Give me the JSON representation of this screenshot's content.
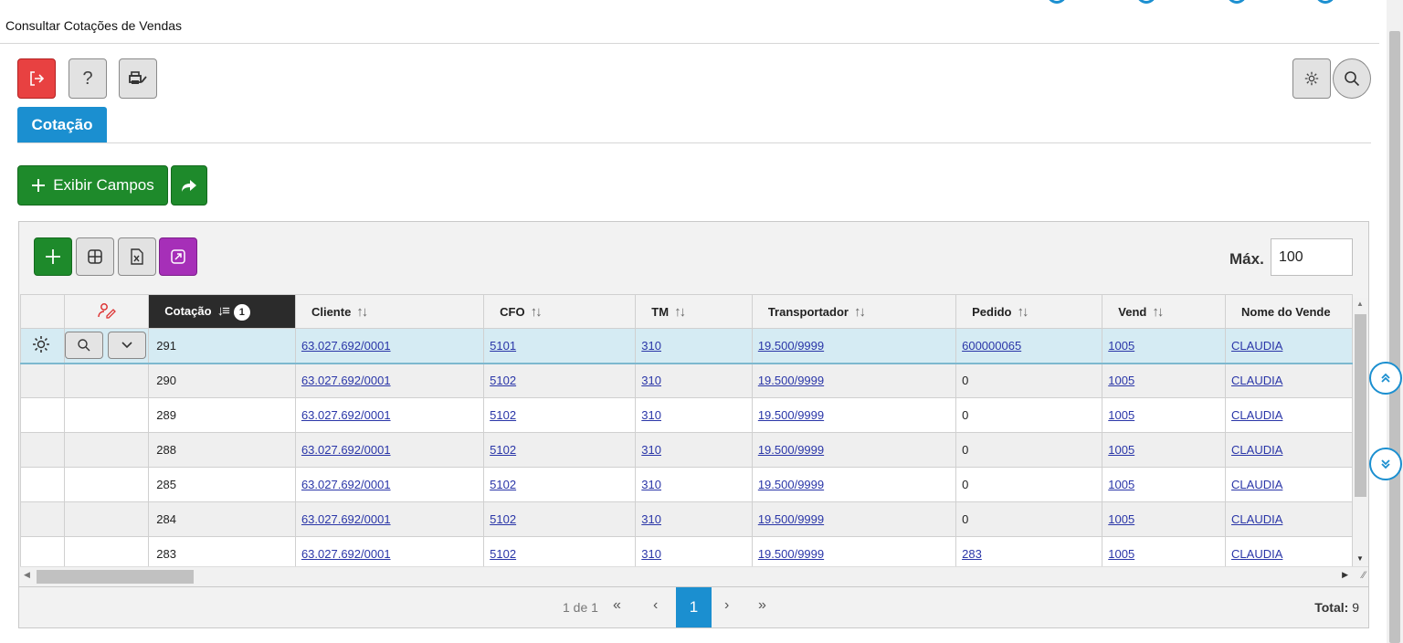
{
  "window": {
    "title": "Consultar Cotações de Vendas"
  },
  "toolbar": {
    "help_label": "?"
  },
  "tabs": [
    {
      "label": "Cotação"
    }
  ],
  "actions": {
    "exibir_label": "Exibir Campos"
  },
  "grid_toolbar": {
    "max_label": "Máx.",
    "max_value": "100"
  },
  "grid": {
    "columns": [
      "Cotação",
      "Cliente",
      "CFO",
      "TM",
      "Transportador",
      "Pedido",
      "Vend",
      "Nome do Vende"
    ],
    "sort_badge": "1",
    "rows": [
      {
        "cotacao": "291",
        "cliente": "63.027.692/0001",
        "cfo": "5101",
        "tm": "310",
        "transportador": "19.500/9999",
        "pedido": "600000065",
        "vend": "1005",
        "nome": "CLAUDIA"
      },
      {
        "cotacao": "290",
        "cliente": "63.027.692/0001",
        "cfo": "5102",
        "tm": "310",
        "transportador": "19.500/9999",
        "pedido": "0",
        "vend": "1005",
        "nome": "CLAUDIA"
      },
      {
        "cotacao": "289",
        "cliente": "63.027.692/0001",
        "cfo": "5102",
        "tm": "310",
        "transportador": "19.500/9999",
        "pedido": "0",
        "vend": "1005",
        "nome": "CLAUDIA"
      },
      {
        "cotacao": "288",
        "cliente": "63.027.692/0001",
        "cfo": "5102",
        "tm": "310",
        "transportador": "19.500/9999",
        "pedido": "0",
        "vend": "1005",
        "nome": "CLAUDIA"
      },
      {
        "cotacao": "285",
        "cliente": "63.027.692/0001",
        "cfo": "5102",
        "tm": "310",
        "transportador": "19.500/9999",
        "pedido": "0",
        "vend": "1005",
        "nome": "CLAUDIA"
      },
      {
        "cotacao": "284",
        "cliente": "63.027.692/0001",
        "cfo": "5102",
        "tm": "310",
        "transportador": "19.500/9999",
        "pedido": "0",
        "vend": "1005",
        "nome": "CLAUDIA"
      },
      {
        "cotacao": "283",
        "cliente": "63.027.692/0001",
        "cfo": "5102",
        "tm": "310",
        "transportador": "19.500/9999",
        "pedido": "283",
        "vend": "1005",
        "nome": "CLAUDIA"
      }
    ]
  },
  "pager": {
    "info": "1 de 1",
    "first": "«",
    "prev": "‹",
    "current": "1",
    "next": "›",
    "last": "»",
    "total_label": "Total:",
    "total_value": "9"
  },
  "icons": {
    "exit": "exit-icon",
    "help": "question-icon",
    "print": "printer-icon",
    "settings": "gear-icon",
    "search": "search-icon",
    "add": "plus-icon",
    "share": "share-icon",
    "columns": "grid-icon",
    "excel": "excel-icon",
    "expand": "expand-icon",
    "scroll_up": "chevron-double-up-icon",
    "scroll_down": "chevron-double-down-icon"
  },
  "colors": {
    "accent": "#1b8fd0",
    "danger": "#e84141",
    "success": "#1e8a2b",
    "purple": "#a62fb8",
    "link": "#2a36a8"
  }
}
